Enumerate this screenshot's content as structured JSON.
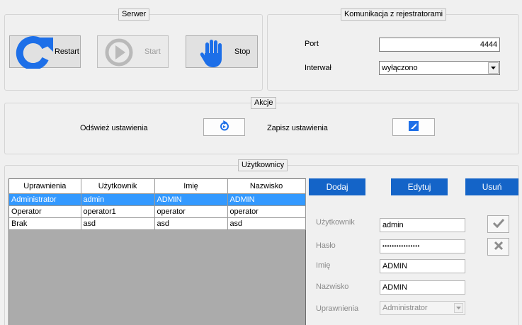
{
  "server": {
    "title": "Serwer",
    "restart_label": "Restart",
    "start_label": "Start",
    "stop_label": "Stop"
  },
  "comm": {
    "title": "Komunikacja z rejestratorami",
    "port_label": "Port",
    "port_value": "4444",
    "interval_label": "Interwał",
    "interval_value": "wyłączono"
  },
  "actions": {
    "title": "Akcje",
    "refresh_label": "Odśwież ustawienia",
    "save_label": "Zapisz ustawienia"
  },
  "users": {
    "title": "Użytkownicy",
    "columns": [
      "Uprawnienia",
      "Użytkownik",
      "Imię",
      "Nazwisko"
    ],
    "rows": [
      [
        "Administrator",
        "admin",
        "ADMIN",
        "ADMIN"
      ],
      [
        "Operator",
        "operator1",
        "operator",
        "operator"
      ],
      [
        "Brak",
        "asd",
        "asd",
        "asd"
      ]
    ],
    "add_label": "Dodaj",
    "edit_label": "Edytuj",
    "delete_label": "Usuń",
    "form": {
      "user_label": "Użytkownik",
      "user_value": "admin",
      "password_label": "Hasło",
      "password_value": "••••••••••••••••",
      "firstname_label": "Imię",
      "firstname_value": "ADMIN",
      "lastname_label": "Nazwisko",
      "lastname_value": "ADMIN",
      "role_label": "Uprawnienia",
      "role_value": "Administrator"
    }
  },
  "colors": {
    "accent_blue": "#1464c8",
    "selection_blue": "#3399ff",
    "stop_hand_blue": "#1d6fe8"
  }
}
